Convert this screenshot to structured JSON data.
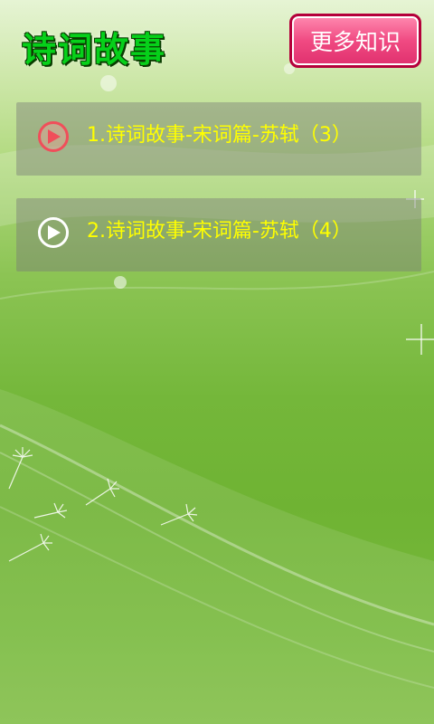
{
  "header": {
    "title": "诗词故事",
    "more_button_label": "更多知识"
  },
  "list": {
    "items": [
      {
        "label": "1.诗词故事-宋词篇-苏轼（3）",
        "icon": "play-icon",
        "active": true
      },
      {
        "label": "2.诗词故事-宋词篇-苏轼（4）",
        "icon": "play-icon",
        "active": false
      }
    ]
  },
  "colors": {
    "title_green": "#06d01a",
    "button_pink": "#f04a82",
    "label_yellow": "#ffff00",
    "active_icon_red": "#f04e5a"
  }
}
